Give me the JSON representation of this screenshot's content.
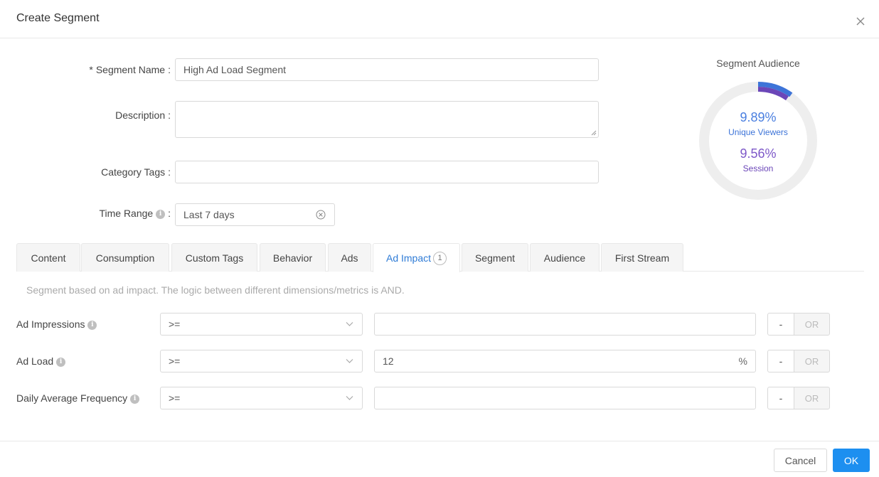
{
  "dialog": {
    "title": "Create Segment",
    "close_icon": "close-icon"
  },
  "form": {
    "segment_name": {
      "required_mark": "*",
      "label": "Segment Name",
      "value": "High Ad Load Segment"
    },
    "description": {
      "label": "Description",
      "value": ""
    },
    "category_tags": {
      "label": "Category Tags",
      "value": ""
    },
    "time_range": {
      "label": "Time Range",
      "value": "Last 7 days",
      "info_icon": "info-icon",
      "clear_icon": "clear-circle-icon"
    },
    "colon": ":"
  },
  "audience": {
    "title": "Segment Audience",
    "unique_viewers_pct": 9.89,
    "unique_viewers_value": "9.89%",
    "unique_viewers_label": "Unique Viewers",
    "session_pct": 9.56,
    "session_value": "9.56%",
    "session_label": "Session",
    "colors": {
      "unique_viewers": "#3d74d8",
      "session": "#6b46b8",
      "track": "#eeeeee"
    }
  },
  "tabs": [
    {
      "label": "Content"
    },
    {
      "label": "Consumption"
    },
    {
      "label": "Custom Tags"
    },
    {
      "label": "Behavior"
    },
    {
      "label": "Ads"
    },
    {
      "label": "Ad Impact",
      "badge": "1",
      "active": true
    },
    {
      "label": "Segment"
    },
    {
      "label": "Audience"
    },
    {
      "label": "First Stream"
    }
  ],
  "hint": "Segment based on ad impact. The logic between different dimensions/metrics is AND.",
  "metrics": [
    {
      "label": "Ad Impressions",
      "operator": ">=",
      "value": "",
      "suffix": ""
    },
    {
      "label": "Ad Load",
      "operator": ">=",
      "value": "12",
      "suffix": "%"
    },
    {
      "label": "Daily Average Frequency",
      "operator": ">=",
      "value": "",
      "suffix": ""
    }
  ],
  "row_buttons": {
    "minus": "-",
    "or": "OR"
  },
  "info_glyph": "i",
  "footer": {
    "cancel": "Cancel",
    "ok": "OK"
  },
  "accent_color": "#1d8ff0"
}
